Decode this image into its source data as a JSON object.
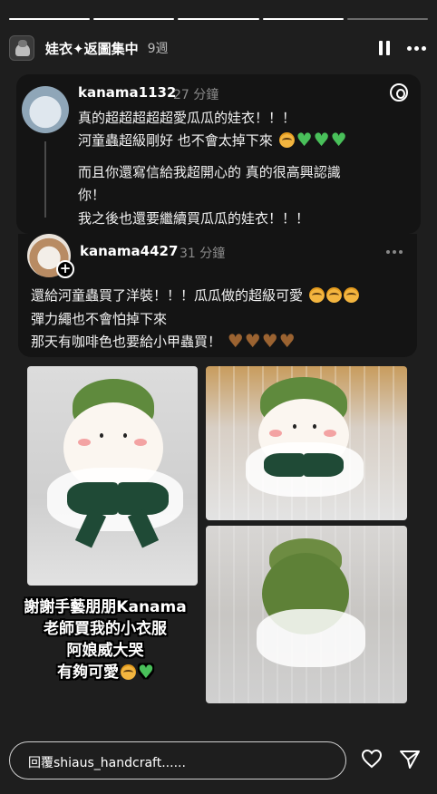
{
  "story": {
    "progress": {
      "total": 5,
      "done": 4
    },
    "highlight_title": "娃衣✦返圖集中",
    "time_ago": "9週"
  },
  "post1": {
    "username": "kanama1132",
    "time": "27 分鐘",
    "lines": [
      "真的超超超超超愛瓜瓜的娃衣！！！",
      "河童蟲超級剛好 也不會太掉下來",
      "而且你還寫信給我超開心的 真的很高興認識",
      "你！",
      "我之後也還要繼續買瓜瓜的娃衣！！！"
    ]
  },
  "post2": {
    "username": "kanama4427",
    "time": "31 分鐘",
    "lines": [
      "還給河童蟲買了洋裝！！！瓜瓜做的超級可愛",
      "彈力繩也不會怕掉下來",
      "那天有咖啡色也要給小甲蟲買！"
    ]
  },
  "sticker_text": [
    "謝謝手藝朋朋Kanama",
    "老師買我的小衣服",
    "阿娘威大哭",
    "有夠可愛"
  ],
  "reply_placeholder": "回覆shiaus_handcraft......",
  "icons": {
    "pause": "pause-icon",
    "more": "more-icon",
    "threads": "threads-logo-icon",
    "heart": "heart-icon",
    "send": "send-icon"
  },
  "colors": {
    "background": "#1e1e1e",
    "card": "#141414",
    "green_heart": "#49c05a",
    "brown_heart": "#9b6331"
  }
}
